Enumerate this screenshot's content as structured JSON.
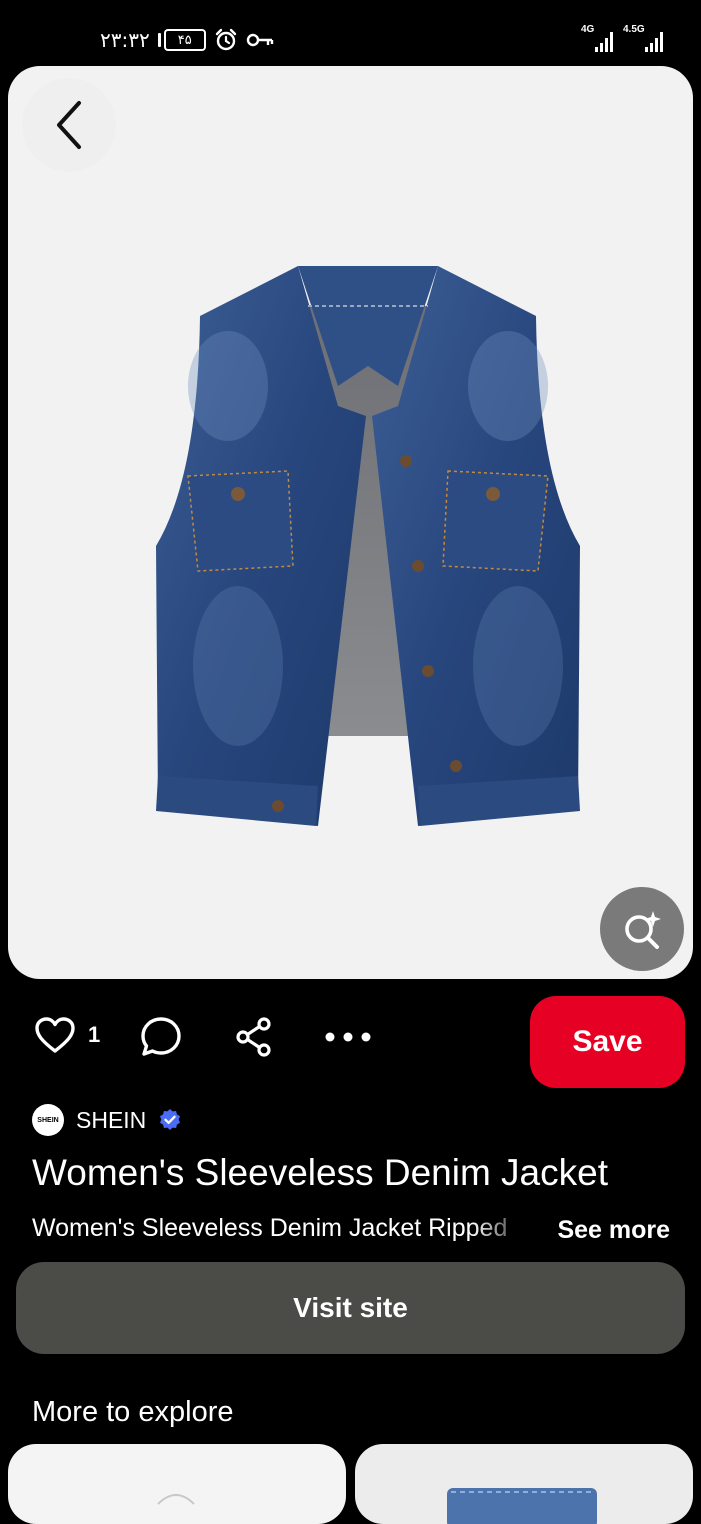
{
  "status_bar": {
    "time": "۲۳:۳۲",
    "battery": "۴۵",
    "network_left": "4G",
    "network_right": "4.5G"
  },
  "pin": {
    "creator": "SHEIN",
    "creator_avatar_text": "SHEIN",
    "title": "Women's Sleeveless Denim Jacket",
    "description": "Women's Sleeveless Denim Jacket Ripped",
    "see_more_label": "See more",
    "like_count": "1"
  },
  "actions": {
    "save_label": "Save",
    "visit_label": "Visit site"
  },
  "explore": {
    "heading": "More to explore"
  },
  "colors": {
    "background": "#000000",
    "save_button": "#e60023",
    "visit_button": "#4b4b48",
    "verified_badge": "#4a6cf7"
  },
  "icons": {
    "back": "chevron-left-icon",
    "lens": "visual-search-icon",
    "like": "heart-icon",
    "comment": "comment-bubble-icon",
    "share": "share-icon",
    "more": "more-dots-icon"
  }
}
